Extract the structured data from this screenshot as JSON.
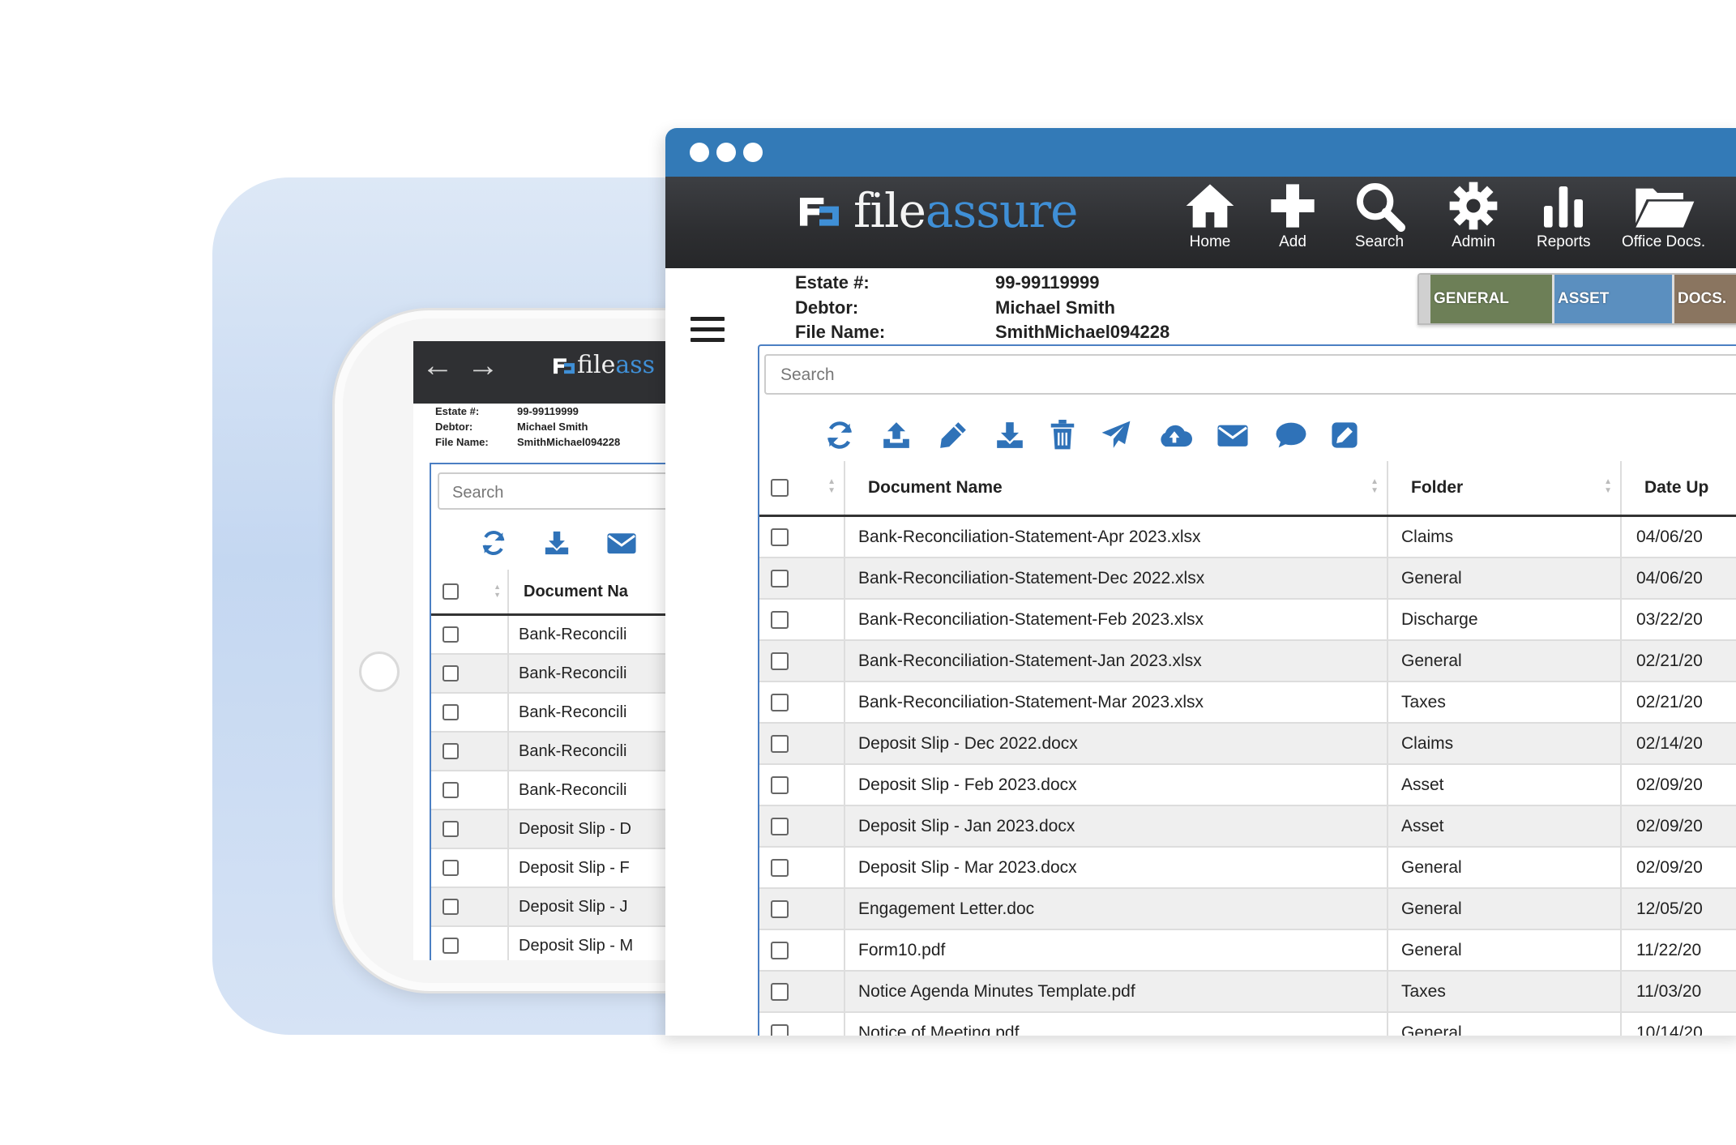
{
  "app": {
    "brand_part1": "file",
    "brand_part2": "assure"
  },
  "nav": [
    {
      "label": "Home",
      "icon": "home-icon"
    },
    {
      "label": "Add",
      "icon": "plus-icon"
    },
    {
      "label": "Search",
      "icon": "search-icon"
    },
    {
      "label": "Admin",
      "icon": "gear-icon"
    },
    {
      "label": "Reports",
      "icon": "bar-chart-icon"
    },
    {
      "label": "Office Docs.",
      "icon": "folder-open-icon"
    }
  ],
  "file_info": {
    "estate_label": "Estate #:",
    "estate_value": "99-99119999",
    "debtor_label": "Debtor:",
    "debtor_value": "Michael Smith",
    "filename_label": "File Name:",
    "filename_value": "SmithMichael094228"
  },
  "folder_tabs": [
    {
      "label": "GENERAL",
      "color": "#6d7f57"
    },
    {
      "label": "ASSET",
      "color": "#5b8fbf"
    },
    {
      "label": "DOCS.",
      "color": "#8a7560"
    }
  ],
  "search": {
    "placeholder": "Search"
  },
  "toolbar": [
    "refresh-icon",
    "upload-icon",
    "edit-pencil-icon",
    "download-icon",
    "trash-icon",
    "send-icon",
    "cloud-upload-icon",
    "envelope-icon",
    "comment-icon",
    "edit-box-icon"
  ],
  "table": {
    "columns": [
      "Document Name",
      "Folder",
      "Date Up"
    ],
    "rows": [
      {
        "name": "Bank-Reconciliation-Statement-Apr 2023.xlsx",
        "folder": "Claims",
        "date": "04/06/20"
      },
      {
        "name": "Bank-Reconciliation-Statement-Dec 2022.xlsx",
        "folder": "General",
        "date": "04/06/20"
      },
      {
        "name": "Bank-Reconciliation-Statement-Feb 2023.xlsx",
        "folder": "Discharge",
        "date": "03/22/20"
      },
      {
        "name": "Bank-Reconciliation-Statement-Jan 2023.xlsx",
        "folder": "General",
        "date": "02/21/20"
      },
      {
        "name": "Bank-Reconciliation-Statement-Mar 2023.xlsx",
        "folder": "Taxes",
        "date": "02/21/20"
      },
      {
        "name": "Deposit Slip - Dec 2022.docx",
        "folder": "Claims",
        "date": "02/14/20"
      },
      {
        "name": "Deposit Slip - Feb 2023.docx",
        "folder": "Asset",
        "date": "02/09/20"
      },
      {
        "name": "Deposit Slip - Jan 2023.docx",
        "folder": "Asset",
        "date": "02/09/20"
      },
      {
        "name": "Deposit Slip - Mar 2023.docx",
        "folder": "General",
        "date": "02/09/20"
      },
      {
        "name": "Engagement Letter.doc",
        "folder": "General",
        "date": "12/05/20"
      },
      {
        "name": "Form10.pdf",
        "folder": "General",
        "date": "11/22/20"
      },
      {
        "name": "Notice Agenda Minutes Template.pdf",
        "folder": "Taxes",
        "date": "11/03/20"
      },
      {
        "name": "Notice of Meeting.pdf",
        "folder": "General",
        "date": "10/14/20"
      }
    ]
  },
  "tablet": {
    "brand_part1": "file",
    "brand_part2": "ass",
    "search_placeholder": "Search",
    "column": "Document Na",
    "rows": [
      "Bank-Reconcili",
      "Bank-Reconcili",
      "Bank-Reconcili",
      "Bank-Reconcili",
      "Bank-Reconcili",
      "Deposit Slip - D",
      "Deposit Slip - F",
      "Deposit Slip - J",
      "Deposit Slip - M"
    ]
  },
  "colors": {
    "accent": "#337ab7",
    "icon_blue": "#2f72b8",
    "header_dark": "#2d2e31"
  }
}
